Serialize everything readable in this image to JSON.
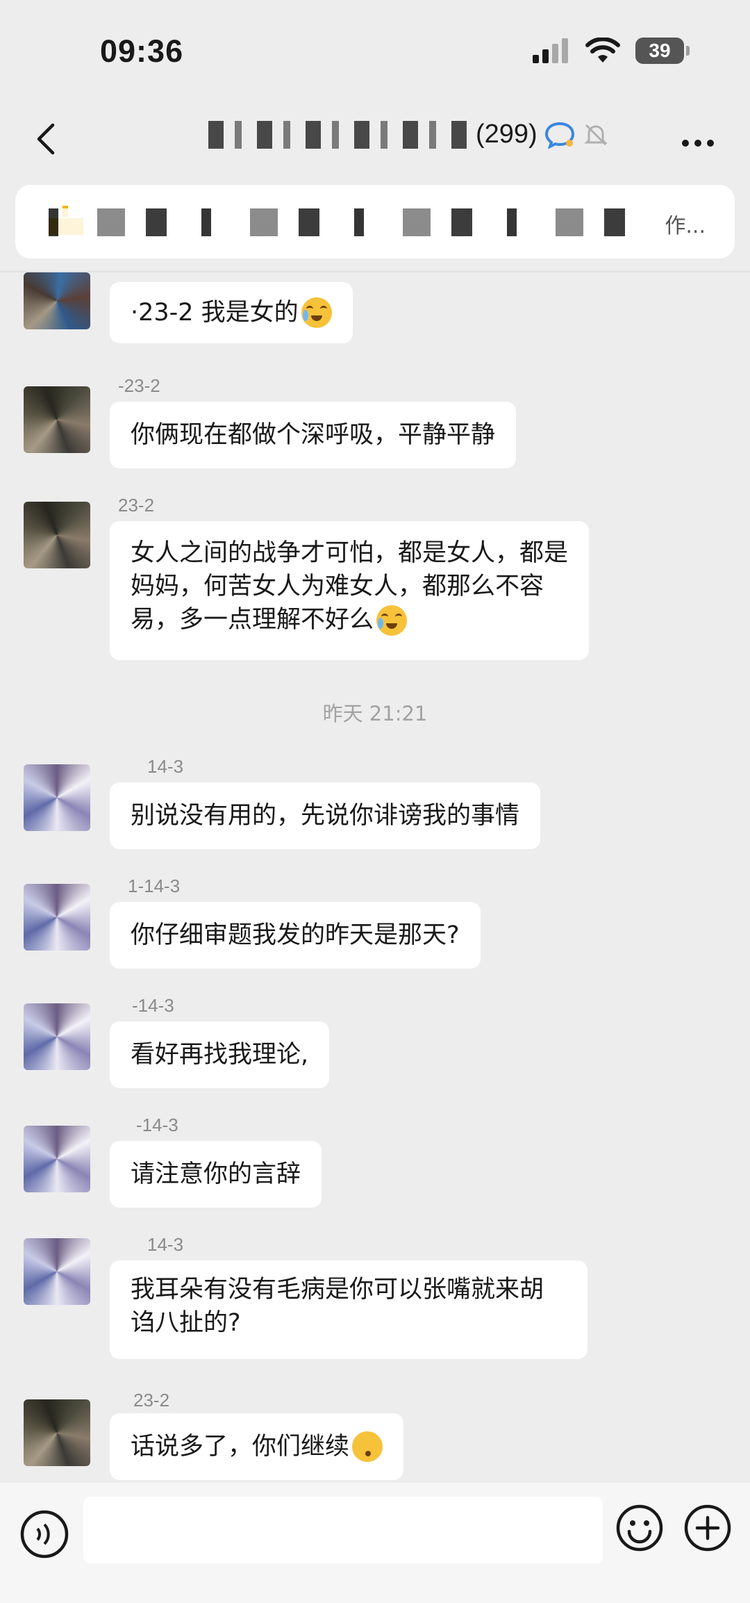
{
  "status_bar": {
    "time": "09:36",
    "battery": "39"
  },
  "nav": {
    "group_count": "(299)"
  },
  "notice": {
    "more": "作..."
  },
  "messages_before": [
    {
      "sender": "",
      "text": "·23-2 我是女的",
      "emoji": "crying-laughing"
    },
    {
      "sender": "-23-2",
      "text": "你俩现在都做个深呼吸，平静平静",
      "emoji": ""
    },
    {
      "sender": "23-2",
      "text": "女人之间的战争才可怕，都是女人，都是妈妈，何苦女人为难女人，都那么不容易，多一点理解不好么",
      "emoji": "crying-laughing"
    }
  ],
  "timestamp": "昨天 21:21",
  "messages_after": [
    {
      "sender": "14-3",
      "text": "别说没有用的，先说你诽谤我的事情",
      "emoji": ""
    },
    {
      "sender": "1-14-3",
      "text": "你仔细审题我发的昨天是那天?",
      "emoji": ""
    },
    {
      "sender": "-14-3",
      "text": "看好再找我理论,",
      "emoji": ""
    },
    {
      "sender": "-14-3",
      "text": "请注意你的言辞",
      "emoji": ""
    },
    {
      "sender": "14-3",
      "text": "我耳朵有没有毛病是你可以张嘴就来胡诌八扯的?",
      "emoji": ""
    },
    {
      "sender": "23-2",
      "text": "话说多了，你们继续",
      "emoji": "kissing-face"
    }
  ],
  "input": {
    "placeholder": ""
  },
  "icons": {
    "back": "chevron-left-icon",
    "more": "ellipsis-icon",
    "voice": "voice-icon",
    "emoji": "emoji-icon",
    "plus": "plus-icon",
    "mute": "bell-off-icon",
    "chat_bubble": "chat-bubble-icon",
    "signal": "signal-icon",
    "wifi": "wifi-icon"
  }
}
